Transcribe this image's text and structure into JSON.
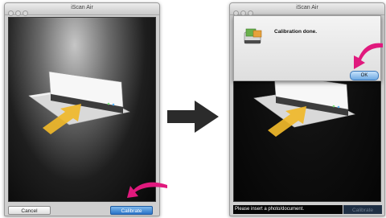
{
  "left_window": {
    "title": "iScan Air",
    "cancel_label": "Cancel",
    "calibrate_label": "Calibrate"
  },
  "right_window": {
    "title": "iScan Air",
    "dialog_message": "Calibration done.",
    "ok_label": "OK",
    "status_text": "Please insert a photo/document.",
    "calibrate_label": "Calibrate"
  },
  "colors": {
    "pointer_arrow": "#e0197d",
    "transition_arrow": "#2b2b2b",
    "primary_button": "#2a73c8"
  }
}
